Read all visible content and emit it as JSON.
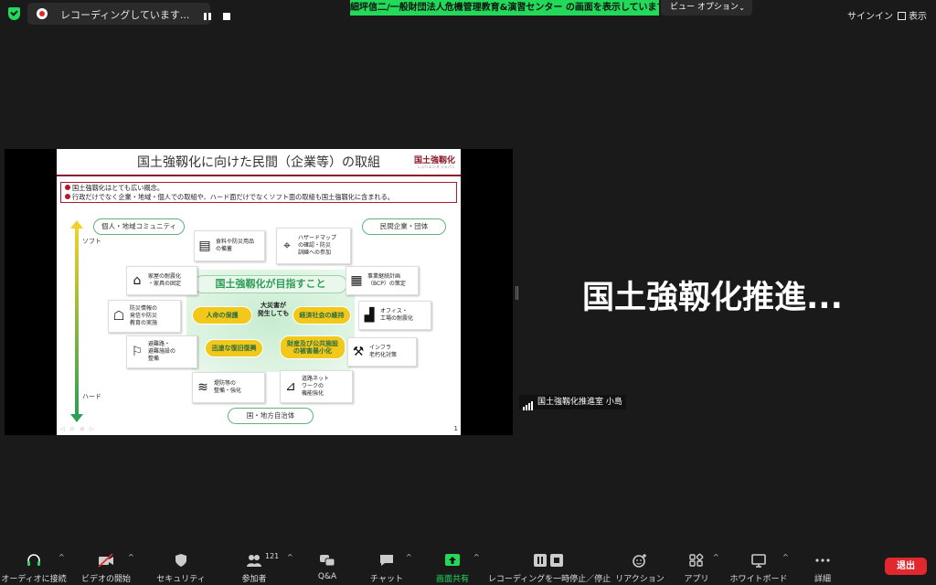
{
  "top": {
    "recording_text": "レコーディングしています...",
    "share_banner": "細坪信二/一般財団法人危機管理教育&演習センター の画面を表示しています",
    "view_options": "ビュー オプション",
    "sign_in": "サインイン",
    "display": "表示"
  },
  "slide": {
    "title": "国土強靱化に向けた民間（企業等）の取組",
    "logo": "国土強靱化",
    "logo_sub": "レジリエンス ジャパン",
    "notes": [
      "国土強靱化はとても広い概念。",
      "行政だけでなく企業・地域・個人での取組や、ハード面だけでなくソフト面の取組も国土強靱化に含まれる。"
    ],
    "axis_top": "ソフト",
    "axis_bottom": "ハード",
    "label_individual": "個人・地域コミュニティ",
    "label_private": "民間企業・団体",
    "label_gov": "国・地方自治体",
    "center_title": "国土強靱化が目指すこと",
    "center_mid": "大災害が\n発生しても",
    "goal_life": "人命の保護",
    "goal_economy": "経済社会の維持",
    "goal_recovery": "迅速な復旧復興",
    "goal_damage": "財産及び公共施設\nの被害最小化",
    "boxes": {
      "stock": "食料や防災用品\nの備蓄",
      "hazard": "ハザードマップ\nの確認・防災\n訓練への参加",
      "home": "家屋の耐震化\n・家具の固定",
      "bcp": "事業継続計画\n（BCP）の策定",
      "info": "防災情報の\n発信や防災\n教育の実施",
      "office": "オフィス・\n工場の耐震化",
      "evac": "避難路・\n避難施設の\n整備",
      "infra": "インフラ\n老朽化対策",
      "levee": "堤防等の\n整備・強化",
      "road": "道路ネット\nワークの\n機能強化"
    },
    "page": "1"
  },
  "speaker": {
    "name": "国土強靱化推進...",
    "label": "国土強靱化推進室 小島"
  },
  "toolbar": {
    "audio": "オーディオに接続",
    "video": "ビデオの開始",
    "security": "セキュリティ",
    "participants": "参加者",
    "participants_count": "121",
    "qa": "Q&A",
    "chat": "チャット",
    "share": "画面共有",
    "pause_rec": "レコーディングを一時停止／停止",
    "reaction": "リアクション",
    "apps": "アプリ",
    "whiteboard": "ホワイトボード",
    "more": "詳細",
    "leave": "退出"
  },
  "colors": {
    "accent_green": "#23d959",
    "leave_red": "#e0282e",
    "slide_maroon": "#8b1a2a"
  }
}
